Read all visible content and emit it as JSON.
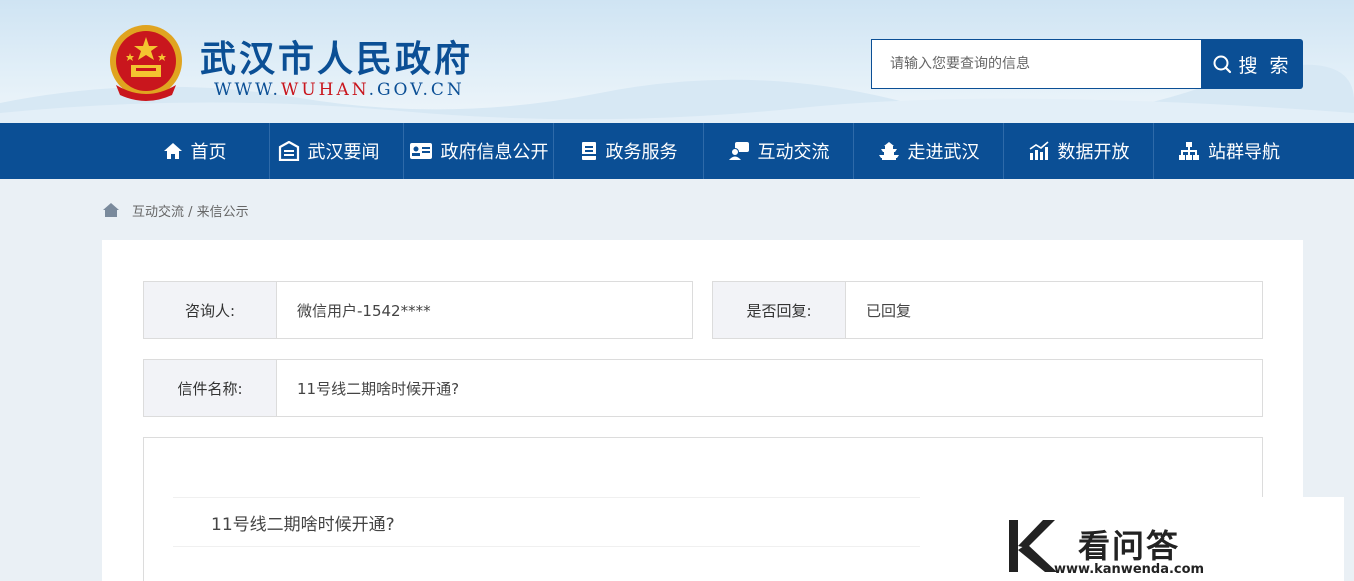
{
  "header": {
    "site_title": "武汉市人民政府",
    "site_url_prefix": "WWW.",
    "site_url_highlight": "WUHAN",
    "site_url_suffix": ".GOV.CN"
  },
  "search": {
    "placeholder": "请输入您要查询的信息",
    "button_label": "搜 索"
  },
  "nav": {
    "items": [
      {
        "label": "首页",
        "icon": "home-icon"
      },
      {
        "label": "武汉要闻",
        "icon": "news-icon"
      },
      {
        "label": "政府信息公开",
        "icon": "info-card-icon"
      },
      {
        "label": "政务服务",
        "icon": "service-doc-icon"
      },
      {
        "label": "互动交流",
        "icon": "chat-icon"
      },
      {
        "label": "走进武汉",
        "icon": "tower-icon"
      },
      {
        "label": "数据开放",
        "icon": "chart-icon"
      },
      {
        "label": "站群导航",
        "icon": "sitemap-icon"
      }
    ]
  },
  "breadcrumb": {
    "path": "互动交流 / 来信公示"
  },
  "letter": {
    "consultant_label": "咨询人:",
    "consultant_value": "微信用户-1542****",
    "replied_label": "是否回复:",
    "replied_value": "已回复",
    "title_label": "信件名称:",
    "title_value": "11号线二期啥时候开通?",
    "question_text": "11号线二期啥时候开通?"
  },
  "watermark": {
    "name": "看问答",
    "url": "www.kanwenda.com"
  },
  "colors": {
    "brand_blue": "#0b4f95",
    "emblem_red": "#c9161d",
    "label_bg": "#f2f3f7"
  }
}
